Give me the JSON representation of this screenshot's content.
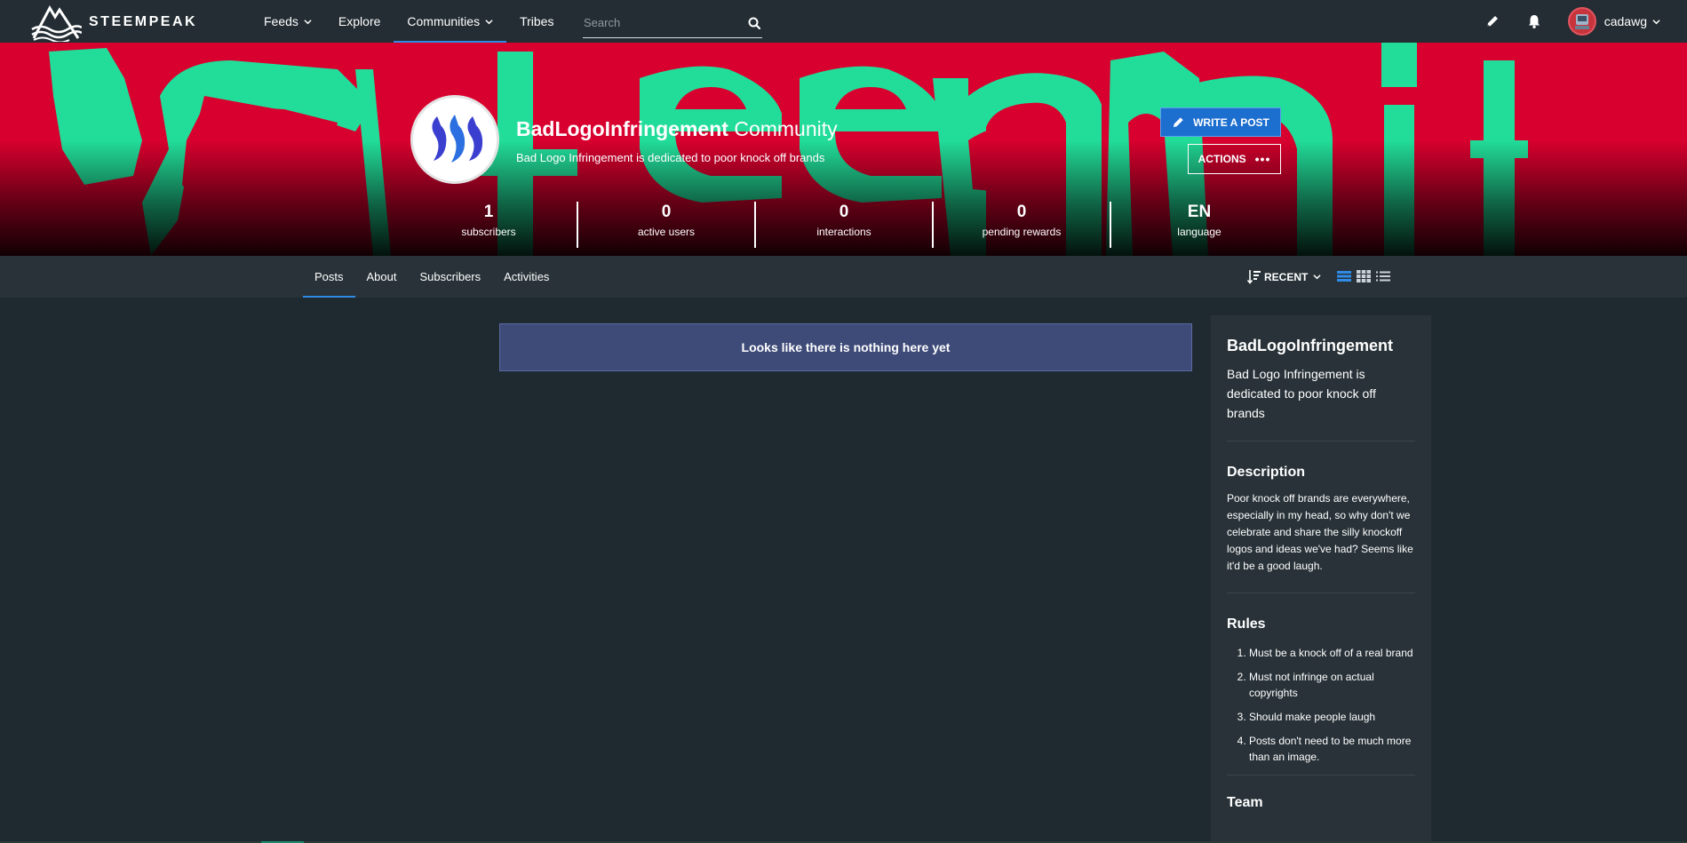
{
  "brand": {
    "name": "STEEMPEAK"
  },
  "nav": {
    "items": [
      {
        "label": "Feeds"
      },
      {
        "label": "Explore"
      },
      {
        "label": "Communities"
      },
      {
        "label": "Tribes"
      }
    ],
    "search_placeholder": "Search"
  },
  "user": {
    "name": "cadawg"
  },
  "community": {
    "name": "BadLogoInfringement",
    "name_suffix": "Community",
    "tagline": "Bad Logo Infringement is dedicated to poor knock off brands",
    "write_label": "WRITE A POST",
    "actions_label": "ACTIONS",
    "stats": [
      {
        "value": "1",
        "label": "subscribers"
      },
      {
        "value": "0",
        "label": "active users"
      },
      {
        "value": "0",
        "label": "interactions"
      },
      {
        "value": "0",
        "label": "pending rewards"
      },
      {
        "value": "EN",
        "label": "language"
      }
    ]
  },
  "tabs": [
    {
      "label": "Posts"
    },
    {
      "label": "About"
    },
    {
      "label": "Subscribers"
    },
    {
      "label": "Activities"
    }
  ],
  "sort": {
    "label": "RECENT"
  },
  "main": {
    "empty_message": "Looks like there is nothing here yet"
  },
  "sidebar": {
    "title": "BadLogoInfringement",
    "about": "Bad Logo Infringement is dedicated to poor knock off brands",
    "description_heading": "Description",
    "description": "Poor knock off brands are everywhere, especially in my head, so why don't we celebrate and share the silly knockoff logos and ideas we've had? Seems like it'd be a good laugh.",
    "rules_heading": "Rules",
    "rules": [
      "Must be a knock off of a real brand",
      "Must not infringe on actual copyrights",
      "Should make people laugh",
      "Posts don't need to be much more than an image."
    ],
    "team_heading": "Team"
  },
  "colors": {
    "banner_red": "#d8002e",
    "banner_green": "#22dd99",
    "accent_blue": "#2f8be6",
    "notice_bg": "#3e4b78"
  },
  "icons": [
    "steempeak-logo",
    "chevron-down-icon",
    "search-icon",
    "pencil-icon",
    "bell-icon",
    "sort-icon",
    "list-view-icon",
    "grid-view-icon",
    "compact-view-icon"
  ]
}
